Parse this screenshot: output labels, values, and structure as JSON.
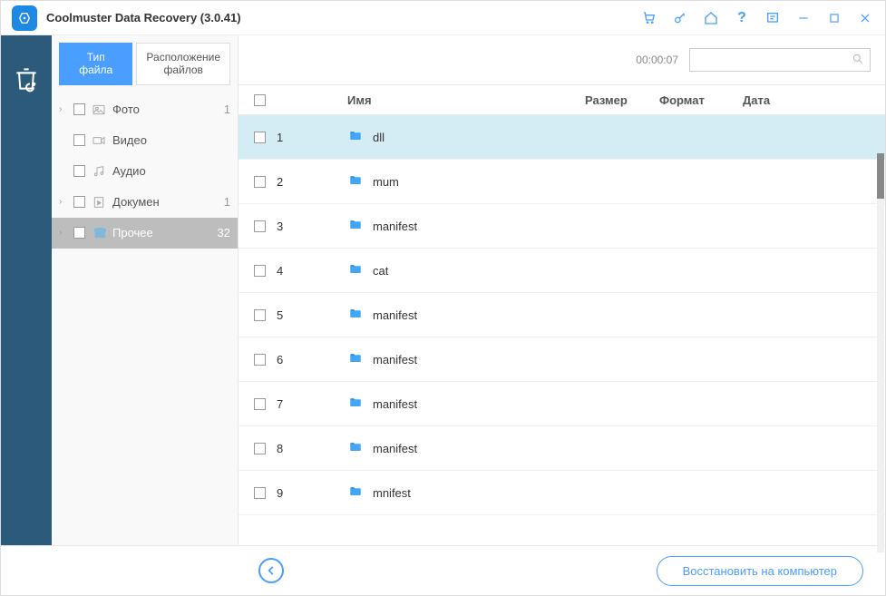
{
  "app": {
    "title": "Coolmuster Data Recovery (3.0.41)"
  },
  "tabs": {
    "file_type": "Тип файла",
    "file_location": "Расположение файлов"
  },
  "tree": [
    {
      "label": "Фото",
      "count": "1",
      "has_arrow": true,
      "selected": false,
      "icon": "photo"
    },
    {
      "label": "Видео",
      "count": "",
      "has_arrow": false,
      "selected": false,
      "icon": "video"
    },
    {
      "label": "Аудио",
      "count": "",
      "has_arrow": false,
      "selected": false,
      "icon": "audio"
    },
    {
      "label": "Докумен",
      "count": "1",
      "has_arrow": true,
      "selected": false,
      "icon": "doc"
    },
    {
      "label": "Прочее",
      "count": "32",
      "has_arrow": true,
      "selected": true,
      "icon": "other"
    }
  ],
  "timer": "00:00:07",
  "table": {
    "headers": {
      "name": "Имя",
      "size": "Размер",
      "format": "Формат",
      "date": "Дата"
    },
    "rows": [
      {
        "num": "1",
        "name": "dll",
        "selected": true
      },
      {
        "num": "2",
        "name": "mum",
        "selected": false
      },
      {
        "num": "3",
        "name": "manifest",
        "selected": false
      },
      {
        "num": "4",
        "name": "cat",
        "selected": false
      },
      {
        "num": "5",
        "name": "manifest",
        "selected": false
      },
      {
        "num": "6",
        "name": "manifest",
        "selected": false
      },
      {
        "num": "7",
        "name": "manifest",
        "selected": false
      },
      {
        "num": "8",
        "name": "manifest",
        "selected": false
      },
      {
        "num": "9",
        "name": "mnifest",
        "selected": false
      }
    ]
  },
  "footer": {
    "recover": "Восстановить на компьютер"
  }
}
